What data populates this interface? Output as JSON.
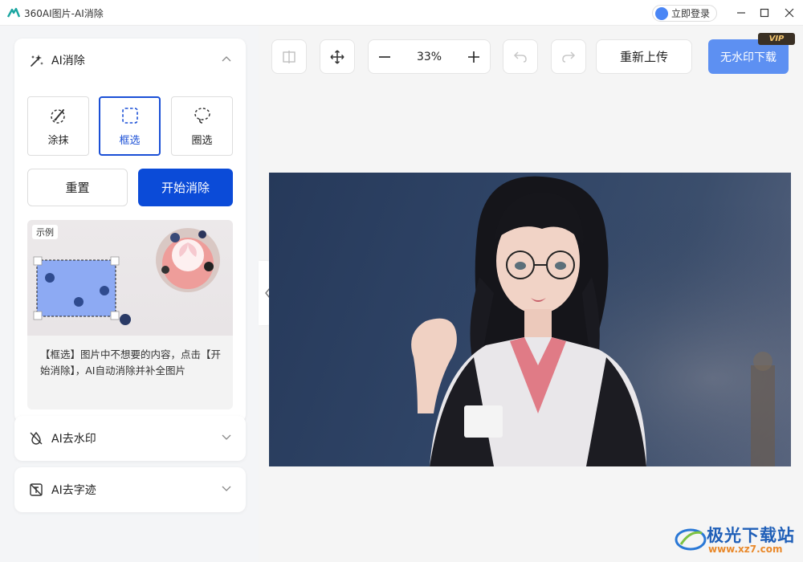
{
  "app": {
    "title": "360AI图片-AI消除"
  },
  "titlebar": {
    "login_label": "立即登录"
  },
  "panel": {
    "erase_section": {
      "title": "AI消除",
      "modes": [
        {
          "label": "涂抹",
          "icon": "brush-icon"
        },
        {
          "label": "框选",
          "icon": "dashed-rect-icon",
          "active": true
        },
        {
          "label": "圈选",
          "icon": "lasso-icon"
        }
      ],
      "reset_label": "重置",
      "start_label": "开始消除",
      "example": {
        "tag": "示例",
        "description": "【框选】图片中不想要的内容，点击【开始消除】，AI自动消除并补全图片"
      }
    },
    "watermark_section": {
      "title": "AI去水印",
      "icon": "no-watermark-icon"
    },
    "text_section": {
      "title": "AI去字迹",
      "icon": "no-text-icon"
    }
  },
  "toolbar": {
    "zoom_value": "33%",
    "reupload_label": "重新上传",
    "download_label": "无水印下载",
    "vip_label": "VIP"
  },
  "colors": {
    "primary": "#0b4bd8",
    "download": "#5d90f2",
    "active_border": "#1a4fd6"
  },
  "watermark": {
    "brand": "极光下载站",
    "url": "www.xz7.com"
  }
}
